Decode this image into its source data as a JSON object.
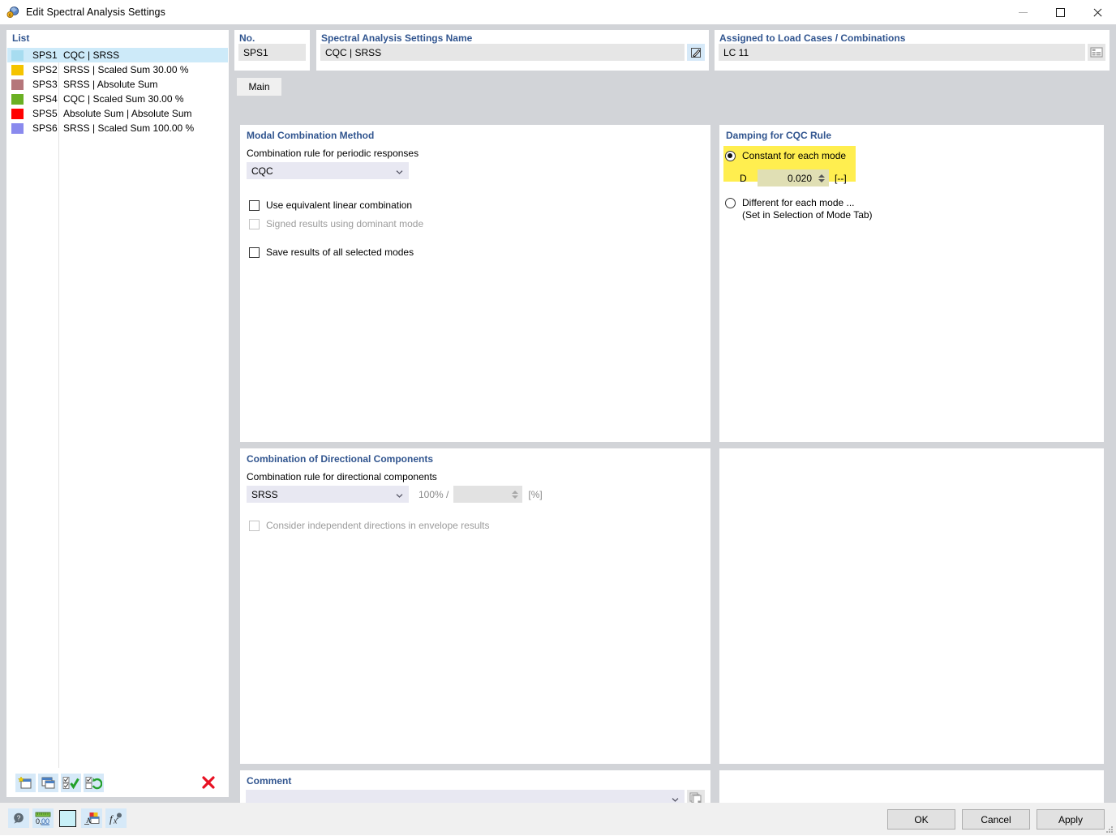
{
  "window": {
    "title": "Edit Spectral Analysis Settings",
    "icon": "spectral-analysis-icon",
    "minimize": "minimize-icon",
    "maximize": "maximize-icon",
    "close": "close-icon"
  },
  "list": {
    "header": "List",
    "items": [
      {
        "color": "#a7dcf0",
        "id": "SPS1",
        "name": "CQC | SRSS",
        "selected": true
      },
      {
        "color": "#f5c400",
        "id": "SPS2",
        "name": "SRSS | Scaled Sum 30.00 %",
        "selected": false
      },
      {
        "color": "#b5767a",
        "id": "SPS3",
        "name": "SRSS | Absolute Sum",
        "selected": false
      },
      {
        "color": "#6ab023",
        "id": "SPS4",
        "name": "CQC | Scaled Sum 30.00 %",
        "selected": false
      },
      {
        "color": "#ff0000",
        "id": "SPS5",
        "name": "Absolute Sum | Absolute Sum",
        "selected": false
      },
      {
        "color": "#8a8aee",
        "id": "SPS6",
        "name": "SRSS | Scaled Sum 100.00 %",
        "selected": false
      }
    ],
    "toolbar": {
      "new_label": "new-item",
      "copy_label": "copy-item",
      "select_all_label": "select-all",
      "invert_label": "invert-selection",
      "delete_label": "delete-item"
    }
  },
  "header": {
    "no_label": "No.",
    "no_value": "SPS1",
    "name_label": "Spectral Analysis Settings Name",
    "name_value": "CQC | SRSS",
    "name_edit_icon": "edit-pencil-icon",
    "assigned_label": "Assigned to Load Cases / Combinations",
    "assigned_value": "LC 11",
    "assigned_button_icon": "load-case-table-icon"
  },
  "tabs": [
    {
      "label": "Main",
      "active": true
    }
  ],
  "modal_combination": {
    "title": "Modal Combination Method",
    "rule_label": "Combination rule for periodic responses",
    "rule_value": "CQC",
    "checkboxes": [
      {
        "label": "Use equivalent linear combination",
        "checked": false,
        "enabled": true
      },
      {
        "label": "Signed results using dominant mode",
        "checked": false,
        "enabled": false
      },
      {
        "label": "Save results of all selected modes",
        "checked": false,
        "enabled": true
      }
    ]
  },
  "damping": {
    "title": "Damping for CQC Rule",
    "option_constant": "Constant for each mode",
    "d_label": "D",
    "d_value": "0.020",
    "d_unit": "[--]",
    "option_different": "Different for each mode ...",
    "option_different_sub": "(Set in Selection of Mode Tab)",
    "selected": "constant",
    "highlight_color": "#ffee4f"
  },
  "directional": {
    "title": "Combination of Directional Components",
    "rule_label": "Combination rule for directional components",
    "rule_value": "SRSS",
    "ratio_prefix": "100% /",
    "ratio_value": "",
    "ratio_unit": "[%]",
    "checkbox_label": "Consider independent directions in envelope results",
    "checkbox_checked": false,
    "checkbox_enabled": false
  },
  "comment": {
    "title": "Comment",
    "value": "",
    "button_icon": "copy-pages-icon"
  },
  "footer": {
    "icons": [
      {
        "name": "help-icon"
      },
      {
        "name": "units-icon"
      },
      {
        "name": "color-swatch-icon"
      },
      {
        "name": "display-properties-icon"
      },
      {
        "name": "formula-icon"
      }
    ],
    "buttons": [
      {
        "label": "OK",
        "name": "ok-button"
      },
      {
        "label": "Cancel",
        "name": "cancel-button"
      },
      {
        "label": "Apply",
        "name": "apply-button"
      }
    ]
  }
}
